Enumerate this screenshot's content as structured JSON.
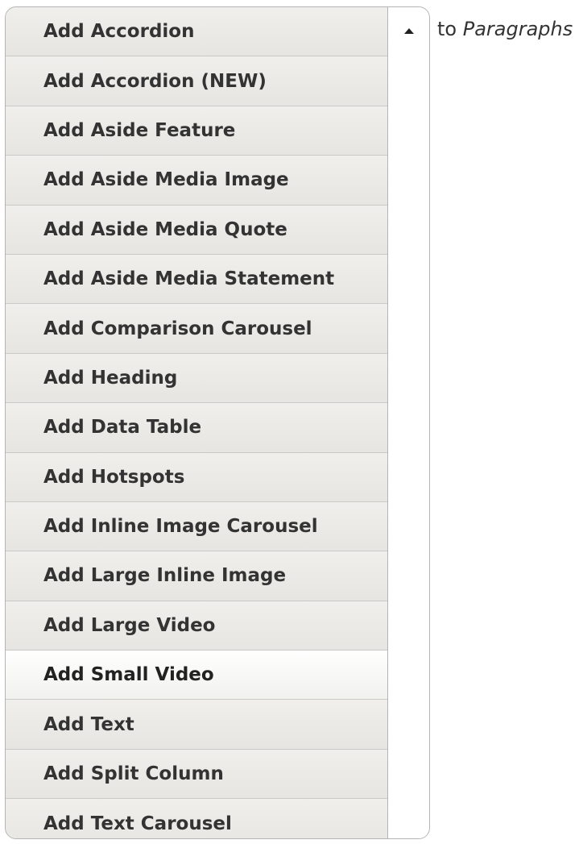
{
  "dropbutton": {
    "items": [
      "Add Accordion",
      "Add Accordion (NEW)",
      "Add Aside Feature",
      "Add Aside Media Image",
      "Add Aside Media Quote",
      "Add Aside Media Statement",
      "Add Comparison Carousel",
      "Add Heading",
      "Add Data Table",
      "Add Hotspots",
      "Add Inline Image Carousel",
      "Add Large Inline Image",
      "Add Large Video",
      "Add Small Video",
      "Add Text",
      "Add Split Column",
      "Add Text Carousel"
    ],
    "highlighted_item": "Add Small Video",
    "toggle_icon": "arrow-up-icon"
  },
  "suffix": {
    "prefix_text": "to",
    "target_text": "Paragraphs"
  },
  "colors": {
    "item_bg": "#ebeae6",
    "border": "#b4b4b4",
    "text": "#333333"
  }
}
